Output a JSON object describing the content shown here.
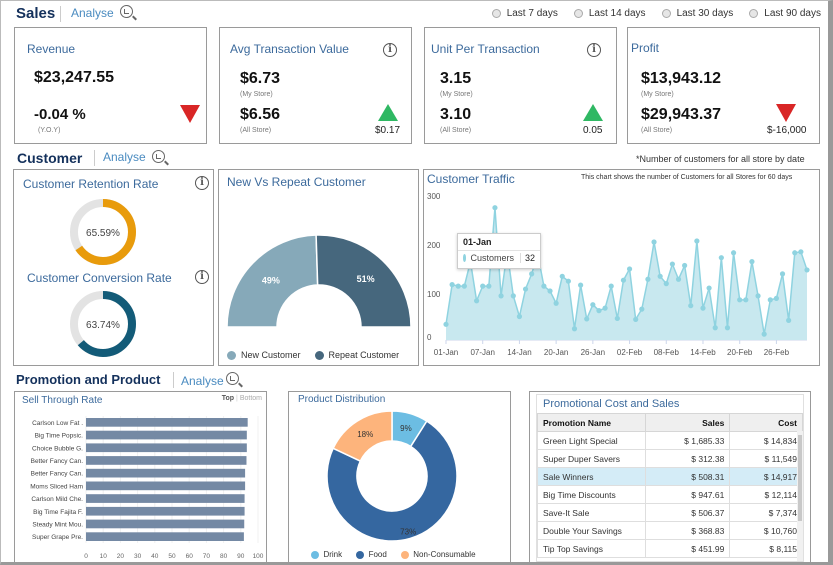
{
  "sales": {
    "title": "Sales",
    "analyse_label": "Analyse",
    "date_filters": [
      "Last 7 days",
      "Last 14 days",
      "Last 30 days",
      "Last 90 days"
    ],
    "kpis": {
      "revenue": {
        "title": "Revenue",
        "value": "$23,247.55",
        "change": "-0.04 %",
        "change_label": "(Y.O.Y)",
        "trend": "down"
      },
      "avg_transaction": {
        "title": "Avg Transaction Value",
        "my_store": "$6.73",
        "my_store_label": "(My Store)",
        "all_store": "$6.56",
        "all_store_label": "(All Store)",
        "delta": "$0.17",
        "trend": "up"
      },
      "unit_per_transaction": {
        "title": "Unit Per Transaction",
        "my_store": "3.15",
        "my_store_label": "(My Store)",
        "all_store": "3.10",
        "all_store_label": "(All Store)",
        "delta": "0.05",
        "trend": "up"
      },
      "profit": {
        "title": "Profit",
        "my_store": "$13,943.12",
        "my_store_label": "(My Store)",
        "all_store": "$29,943.37",
        "all_store_label": "(All Store)",
        "delta": "$-16,000",
        "trend": "down"
      }
    }
  },
  "customer": {
    "title": "Customer",
    "analyse_label": "Analyse",
    "note": "*Number of customers for all store by date",
    "retention": {
      "title": "Customer Retention Rate",
      "value": 65.59,
      "label": "65.59%",
      "color": "#e89b0c"
    },
    "conversion": {
      "title": "Customer Conversion Rate",
      "value": 63.74,
      "label": "63.74%",
      "color": "#135b78"
    },
    "new_vs_repeat": {
      "title": "New Vs Repeat Customer",
      "slices": [
        {
          "name": "New Customer",
          "value": 49,
          "label": "49%",
          "color": "#86a9b9"
        },
        {
          "name": "Repeat Customer",
          "value": 51,
          "label": "51%",
          "color": "#46677d"
        }
      ]
    },
    "traffic": {
      "title": "Customer Traffic",
      "subtitle": "This chart shows the number of Customers for all Stores for 60 days",
      "tooltip": {
        "date": "01-Jan",
        "series": "Customers",
        "value": "32"
      }
    }
  },
  "promotion": {
    "title": "Promotion and Product",
    "analyse_label": "Analyse",
    "sell_through": {
      "title": "Sell Through Rate",
      "toggle_top": "Top",
      "toggle_bottom": "Bottom"
    },
    "product_distribution": {
      "title": "Product Distribution"
    },
    "promo_table": {
      "title": "Promotional Cost and Sales",
      "columns": [
        "Promotion Name",
        "Sales",
        "Cost"
      ],
      "rows": [
        [
          "Green Light Special",
          "$ 1,685.33",
          "$ 14,834"
        ],
        [
          "Super Duper Savers",
          "$ 312.38",
          "$ 11,549"
        ],
        [
          "Sale Winners",
          "$ 508.31",
          "$ 14,917"
        ],
        [
          "Big Time Discounts",
          "$ 947.61",
          "$ 12,114"
        ],
        [
          "Save-It Sale",
          "$ 506.37",
          "$ 7,374"
        ],
        [
          "Double Your Savings",
          "$ 368.83",
          "$ 10,760"
        ],
        [
          "Tip Top Savings",
          "$ 451.99",
          "$ 8,115"
        ]
      ],
      "selected_row": 2
    }
  },
  "chart_data": [
    {
      "type": "area",
      "title": "Customer Traffic",
      "subtitle": "This chart shows the number of Customers for all Stores for 60 days",
      "series_name": "Customers",
      "color": "#8fd3e0",
      "ylim": [
        0,
        300
      ],
      "yticks": [
        0,
        100,
        200,
        300
      ],
      "xtick_labels": [
        "01-Jan",
        "07-Jan",
        "14-Jan",
        "20-Jan",
        "26-Jan",
        "02-Feb",
        "08-Feb",
        "14-Feb",
        "20-Feb",
        "26-Feb"
      ],
      "xtick_indices": [
        0,
        6,
        12,
        18,
        24,
        30,
        36,
        42,
        48,
        54
      ],
      "values": [
        32,
        113,
        110,
        110,
        160,
        80,
        110,
        110,
        270,
        90,
        180,
        90,
        48,
        104,
        135,
        175,
        110,
        100,
        75,
        130,
        120,
        23,
        112,
        43,
        72,
        60,
        65,
        110,
        44,
        122,
        145,
        42,
        63,
        124,
        200,
        130,
        115,
        155,
        124,
        152,
        70,
        202,
        65,
        106,
        25,
        168,
        25,
        178,
        82,
        82,
        160,
        90,
        12,
        82,
        85,
        135,
        40,
        178,
        180,
        143
      ]
    },
    {
      "type": "bar",
      "orientation": "horizontal",
      "title": "Sell Through Rate",
      "categories": [
        "Carlson Low Fat .",
        "Big Time Popsic.",
        "Choice Bubble G.",
        "Better Fancy Can.",
        "Better Fancy Can.",
        "Moms Sliced Ham",
        "Carlson Mild Che.",
        "Big Time Fajita F.",
        "Steady Mint Mou.",
        "Super Grape Pre."
      ],
      "values": [
        94,
        93.5,
        93.5,
        93.3,
        92.5,
        92.5,
        92.2,
        92.2,
        92,
        91.8
      ],
      "xlim": [
        0,
        100
      ],
      "xticks": [
        0,
        10,
        20,
        30,
        40,
        50,
        60,
        70,
        80,
        90,
        100
      ],
      "color": "#7489a4"
    },
    {
      "type": "pie",
      "title": "Product Distribution",
      "donut": true,
      "slices": [
        {
          "name": "Drink",
          "value": 9,
          "label": "9%",
          "color": "#6cbde3"
        },
        {
          "name": "Food",
          "value": 73,
          "label": "73%",
          "color": "#3567a0"
        },
        {
          "name": "Non-Consumable",
          "value": 18,
          "label": "18%",
          "color": "#fdb47c"
        }
      ],
      "legend": "bottom"
    },
    {
      "type": "pie",
      "title": "New Vs Repeat Customer",
      "semicircle": true,
      "slices": [
        {
          "name": "New Customer",
          "value": 49,
          "label": "49%",
          "color": "#86a9b9"
        },
        {
          "name": "Repeat Customer",
          "value": 51,
          "label": "51%",
          "color": "#46677d"
        }
      ],
      "legend": "bottom"
    }
  ]
}
